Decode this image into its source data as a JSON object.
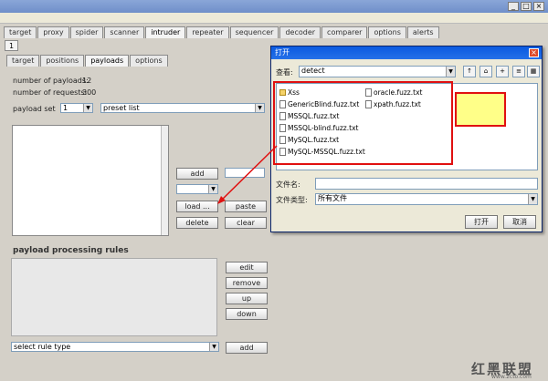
{
  "window": {
    "title": "",
    "minimize_label": "_",
    "maximize_label": "□",
    "close_label": "×"
  },
  "menu": [],
  "main_tabs": [
    "target",
    "proxy",
    "spider",
    "scanner",
    "intruder",
    "repeater",
    "sequencer",
    "decoder",
    "comparer",
    "options",
    "alerts"
  ],
  "main_tab_active": 4,
  "attack_tab_number": "1",
  "intruder_tabs": [
    "target",
    "positions",
    "payloads",
    "options"
  ],
  "intruder_tab_active": 2,
  "payload_info": {
    "num_payloads_label": "number of payloads:",
    "num_payloads_value": "12",
    "num_requests_label": "number of requests:",
    "num_requests_value": "300"
  },
  "payload_set": {
    "label": "payload set",
    "set_value": "1",
    "type_value": "preset list"
  },
  "payload_list": [],
  "payload_buttons": {
    "add": "add",
    "load": "load ...",
    "paste": "paste",
    "delete": "delete",
    "clear": "clear"
  },
  "processing": {
    "title": "payload processing rules",
    "edit": "edit",
    "remove": "remove",
    "up": "up",
    "down": "down",
    "rule_select": "select rule type",
    "add": "add"
  },
  "dialog": {
    "title": "打开",
    "lookin_label": "查看:",
    "lookin_value": "detect",
    "files": [
      "Xss",
      "GenericBlind.fuzz.txt",
      "MSSQL.fuzz.txt",
      "MSSQL-blind.fuzz.txt",
      "MySQL.fuzz.txt",
      "MySQL-MSSQL.fuzz.txt",
      "oracle.fuzz.txt",
      "xpath.fuzz.txt"
    ],
    "filename_label": "文件名:",
    "filetype_label": "文件类型:",
    "filetype_value": "所有文件",
    "open_button": "打开",
    "cancel_button": "取消",
    "toolbar_icons": [
      "up-folder-icon",
      "home-icon",
      "new-folder-icon",
      "list-view-icon",
      "details-view-icon"
    ]
  },
  "annotation": {
    "line1": "",
    "line2": "",
    "color": "#e01010"
  },
  "watermark": {
    "text": "红黑联盟",
    "url": "www.2cto.com"
  }
}
